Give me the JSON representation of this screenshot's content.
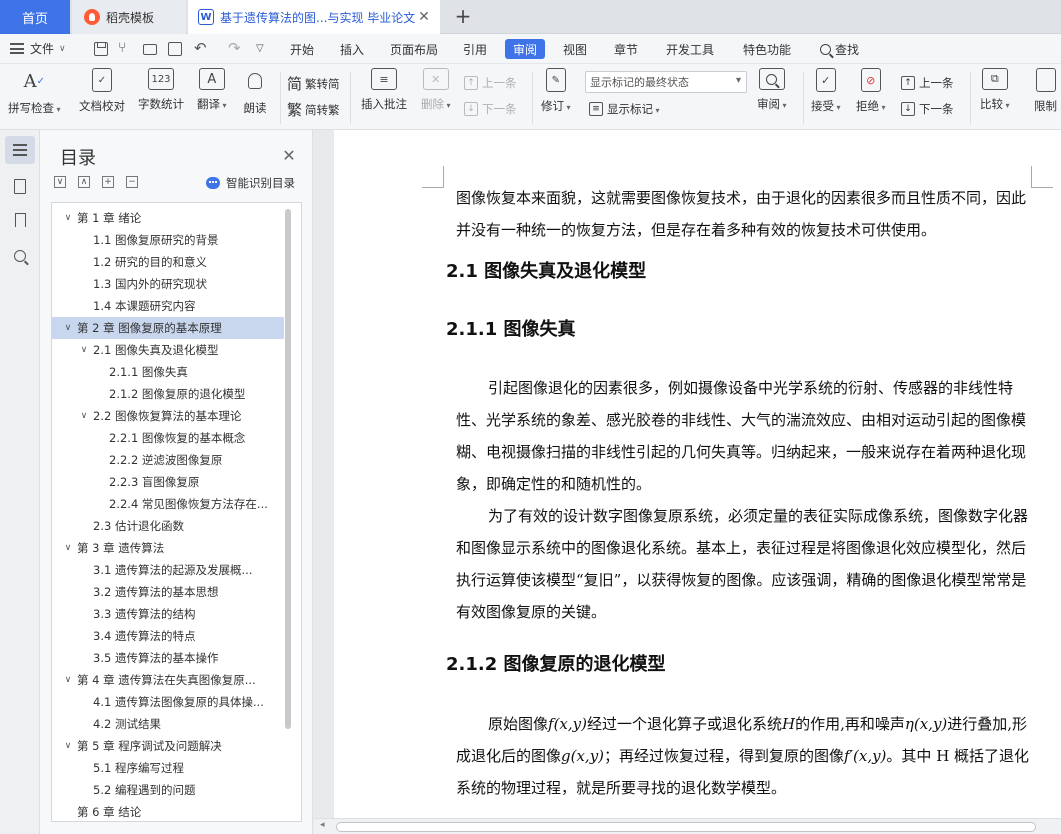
{
  "tabs": {
    "home": "首页",
    "template": "稻壳模板",
    "document": "基于遗传算法的图...与实现 毕业论文",
    "close": "✕",
    "add": "+"
  },
  "menu": {
    "file": "文件",
    "items": [
      "开始",
      "插入",
      "页面布局",
      "引用",
      "审阅",
      "视图",
      "章节",
      "开发工具",
      "特色功能"
    ],
    "active": "审阅",
    "search": "查找"
  },
  "ribbon": {
    "spell_check": "拼写检查",
    "doc_check": "文档校对",
    "word_count": "字数统计",
    "translate": "翻译",
    "read_aloud": "朗读",
    "trad_to_simp": "繁转简",
    "simp_to_trad": "简转繁",
    "insert_comment": "插入批注",
    "delete": "删除",
    "prev_comment": "上一条",
    "next_comment": "下一条",
    "track_changes": "修订",
    "markup_mode": "显示标记的最终状态",
    "show_markup": "显示标记",
    "review": "审阅",
    "accept": "接受",
    "reject": "拒绝",
    "prev_change": "上一条",
    "next_change": "下一条",
    "compare": "比较",
    "restrict": "限制"
  },
  "toc": {
    "title": "目录",
    "smart": "智能识别目录",
    "items": [
      {
        "text": "第 1 章  绪论",
        "level": 0,
        "caret": "∨"
      },
      {
        "text": "1.1   图像复原研究的背景",
        "level": 1
      },
      {
        "text": "1.2   研究的目的和意义",
        "level": 1
      },
      {
        "text": "1.3   国内外的研究现状",
        "level": 1
      },
      {
        "text": "1.4   本课题研究内容",
        "level": 1
      },
      {
        "text": "第 2 章  图像复原的基本原理",
        "level": 0,
        "caret": "∨",
        "selected": true
      },
      {
        "text": "2.1   图像失真及退化模型",
        "level": 1,
        "caret": "∨"
      },
      {
        "text": "2.1.1  图像失真",
        "level": 2
      },
      {
        "text": "2.1.2  图像复原的退化模型",
        "level": 2
      },
      {
        "text": "2.2 图像恢复算法的基本理论",
        "level": 1,
        "caret": "∨"
      },
      {
        "text": "2.2.1   图像恢复的基本概念",
        "level": 2
      },
      {
        "text": "2.2.2   逆滤波图像复原",
        "level": 2
      },
      {
        "text": "2.2.3   盲图像复原",
        "level": 2
      },
      {
        "text": "2.2.4 常见图像恢复方法存在...",
        "level": 2
      },
      {
        "text": "2.3   估计退化函数",
        "level": 1
      },
      {
        "text": "第 3 章  遗传算法",
        "level": 0,
        "caret": "∨"
      },
      {
        "text": "3.1   遗传算法的起源及发展概...",
        "level": 1
      },
      {
        "text": "3.2   遗传算法的基本思想",
        "level": 1
      },
      {
        "text": "3.3   遗传算法的结构",
        "level": 1
      },
      {
        "text": "3.4 遗传算法的特点",
        "level": 1
      },
      {
        "text": "3.5 遗传算法的基本操作",
        "level": 1
      },
      {
        "text": "第 4 章  遗传算法在失真图像复原...",
        "level": 0,
        "caret": "∨"
      },
      {
        "text": "4.1 遗传算法图像复原的具体操...",
        "level": 1
      },
      {
        "text": "4.2  测试结果",
        "level": 1
      },
      {
        "text": "第 5 章  程序调试及问题解决",
        "level": 0,
        "caret": "∨"
      },
      {
        "text": "5.1  程序编写过程",
        "level": 1
      },
      {
        "text": "5.2  编程遇到的问题",
        "level": 1
      },
      {
        "text": "第 6 章  结论",
        "level": 0
      }
    ]
  },
  "document": {
    "para0": "图像恢复本来面貌，这就需要图像恢复技术，由于退化的因素很多而且性质不同，因此并没有一种统一的恢复方法，但是存在着多种有效的恢复技术可供使用。",
    "h21": "2.1   图像失真及退化模型",
    "h211": "2.1.1  图像失真",
    "para1": "引起图像退化的因素很多，例如摄像设备中光学系统的衍射、传感器的非线性特性、光学系统的象差、感光胶卷的非线性、大气的湍流效应、由相对运动引起的图像模糊、电视摄像扫描的非线性引起的几何失真等。归纳起来，一般来说存在着两种退化现象，即确定性的和随机性的。",
    "para2": "为了有效的设计数字图像复原系统，必须定量的表征实际成像系统，图像数字化器和图像显示系统中的图像退化系统。基本上，表征过程是将图像退化效应模型化，然后执行运算使该模型“复旧”，以获得恢复的图像。应该强调，精确的图像退化模型常常是有效图像复原的关键。",
    "h212": "2.1.2  图像复原的退化模型",
    "para3_a": "原始图像",
    "para3_f": "f(x,y)",
    "para3_b": "经过一个退化算子或退化系统",
    "para3_H": "H",
    "para3_c": "的作用,再和噪声",
    "para3_eta": "η(x,y)",
    "para3_d": "进行叠加,形成退化后的图像",
    "para3_g": "g(x,y)",
    "para3_e": "；再经过恢复过程，得到复原的图像",
    "para3_fp": "f′(x,y)",
    "para3_end": "。其中 H 概括了退化系统的物理过程，就是所要寻找的退化数学模型。"
  }
}
